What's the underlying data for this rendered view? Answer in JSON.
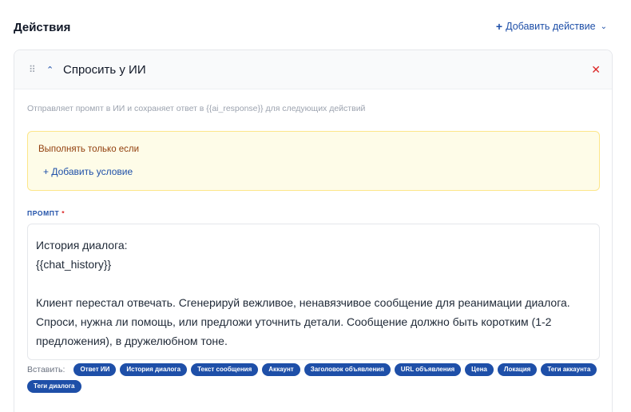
{
  "section": {
    "title": "Действия",
    "add_action_label": "Добавить действие"
  },
  "action": {
    "title": "Спросить у ИИ",
    "description": "Отправляет промпт в ИИ и сохраняет ответ в {{ai_response}} для следующих действий",
    "condition": {
      "label": "Выполнять только если",
      "add_label": "+ Добавить условие"
    },
    "prompt": {
      "label": "ПРОМПТ",
      "required_mark": "*",
      "value": "История диалога:\n{{chat_history}}\n\nКлиент перестал отвечать. Сгенерируй вежливое, ненавязчивое сообщение для реанимации диалога. Спроси, нужна ли помощь, или предложи уточнить детали. Сообщение должно быть коротким (1-2 предложения), в дружелюбном тоне."
    },
    "insert": {
      "label": "Вставить:",
      "chips": [
        "Ответ ИИ",
        "История диалога",
        "Текст сообщения",
        "Аккаунт",
        "Заголовок объявления",
        "URL объявления",
        "Цена",
        "Локация",
        "Теги аккаунта",
        "Теги диалога"
      ]
    }
  },
  "icons": {
    "drag": "drag-handle-icon",
    "collapse": "chevron-up-icon",
    "close": "close-icon",
    "add": "plus-icon",
    "dropdown": "chevron-down-icon"
  },
  "colors": {
    "accent": "#1e4fa8",
    "danger": "#dc2626",
    "condition_bg": "#fefce8",
    "condition_text": "#92400e"
  }
}
